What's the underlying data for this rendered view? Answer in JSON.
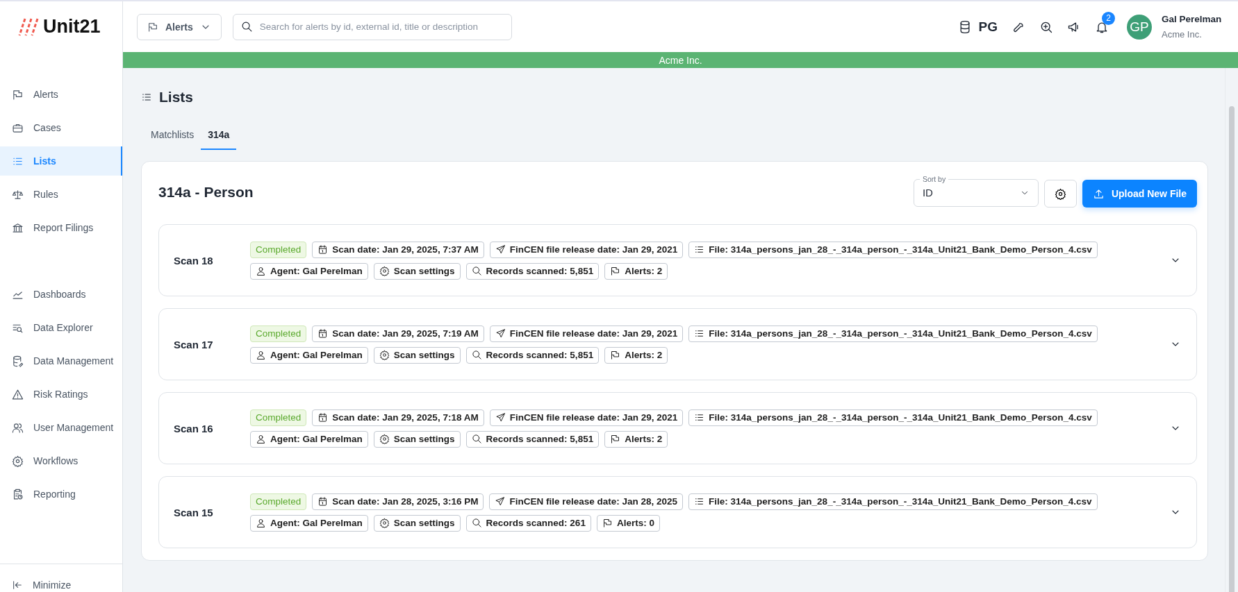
{
  "logo": {
    "text": "Unit21"
  },
  "header": {
    "module_selector": "Alerts",
    "search": {
      "placeholder": "Search for alerts by id, external id, title or description"
    },
    "tenant_code": "PG",
    "notification_count": "2",
    "user": {
      "initials": "GP",
      "name": "Gal Perelman",
      "org": "Acme Inc."
    }
  },
  "banner": "Acme Inc.",
  "sidebar": {
    "sections": [
      {
        "items": [
          {
            "label": "Alerts",
            "selected": false
          },
          {
            "label": "Cases",
            "selected": false
          },
          {
            "label": "Lists",
            "selected": true
          },
          {
            "label": "Rules",
            "selected": false
          },
          {
            "label": "Report Filings",
            "selected": false
          }
        ]
      },
      {
        "items": [
          {
            "label": "Dashboards",
            "selected": false
          },
          {
            "label": "Data Explorer",
            "selected": false
          },
          {
            "label": "Data Management",
            "selected": false
          },
          {
            "label": "Risk Ratings",
            "selected": false
          },
          {
            "label": "User Management",
            "selected": false
          },
          {
            "label": "Workflows",
            "selected": false
          },
          {
            "label": "Reporting",
            "selected": false
          }
        ]
      }
    ],
    "minimize": "Minimize"
  },
  "page": {
    "title": "Lists",
    "tabs": [
      {
        "label": "Matchlists",
        "selected": false
      },
      {
        "label": "314a",
        "selected": true
      }
    ],
    "card": {
      "title": "314a - Person",
      "sort": {
        "label": "Sort by",
        "value": "ID"
      },
      "upload_button": "Upload New File",
      "scans": [
        {
          "name": "Scan 18",
          "chip_rows": [
            {
              "chips": [
                {
                  "kind": "status",
                  "text": "Completed"
                },
                {
                  "kind": "scan_date",
                  "text": "Scan date: Jan 29, 2025, 7:37 AM"
                },
                {
                  "kind": "release",
                  "text": "FinCEN file release date: Jan 29, 2021"
                },
                {
                  "kind": "file",
                  "text": "File: 314a_persons_jan_28_-_314a_person_-_314a_Unit21_Bank_Demo_Person_4.csv"
                }
              ]
            },
            {
              "chips": [
                {
                  "kind": "agent",
                  "text": "Agent: Gal Perelman"
                },
                {
                  "kind": "settings",
                  "text": "Scan settings"
                },
                {
                  "kind": "records",
                  "text": "Records scanned: 5,851"
                },
                {
                  "kind": "alerts",
                  "text": "Alerts: 2"
                }
              ]
            }
          ]
        },
        {
          "name": "Scan 17",
          "chip_rows": [
            {
              "chips": [
                {
                  "kind": "status",
                  "text": "Completed"
                },
                {
                  "kind": "scan_date",
                  "text": "Scan date: Jan 29, 2025, 7:19 AM"
                },
                {
                  "kind": "release",
                  "text": "FinCEN file release date: Jan 29, 2021"
                },
                {
                  "kind": "file",
                  "text": "File: 314a_persons_jan_28_-_314a_person_-_314a_Unit21_Bank_Demo_Person_4.csv"
                }
              ]
            },
            {
              "chips": [
                {
                  "kind": "agent",
                  "text": "Agent: Gal Perelman"
                },
                {
                  "kind": "settings",
                  "text": "Scan settings"
                },
                {
                  "kind": "records",
                  "text": "Records scanned: 5,851"
                },
                {
                  "kind": "alerts",
                  "text": "Alerts: 2"
                }
              ]
            }
          ]
        },
        {
          "name": "Scan 16",
          "chip_rows": [
            {
              "chips": [
                {
                  "kind": "status",
                  "text": "Completed"
                },
                {
                  "kind": "scan_date",
                  "text": "Scan date: Jan 29, 2025, 7:18 AM"
                },
                {
                  "kind": "release",
                  "text": "FinCEN file release date: Jan 29, 2021"
                },
                {
                  "kind": "file",
                  "text": "File: 314a_persons_jan_28_-_314a_person_-_314a_Unit21_Bank_Demo_Person_4.csv"
                }
              ]
            },
            {
              "chips": [
                {
                  "kind": "agent",
                  "text": "Agent: Gal Perelman"
                },
                {
                  "kind": "settings",
                  "text": "Scan settings"
                },
                {
                  "kind": "records",
                  "text": "Records scanned: 5,851"
                },
                {
                  "kind": "alerts",
                  "text": "Alerts: 2"
                }
              ]
            }
          ]
        },
        {
          "name": "Scan 15",
          "chip_rows": [
            {
              "chips": [
                {
                  "kind": "status",
                  "text": "Completed"
                },
                {
                  "kind": "scan_date",
                  "text": "Scan date: Jan 28, 2025, 3:16 PM"
                },
                {
                  "kind": "release",
                  "text": "FinCEN file release date: Jan 28, 2025"
                },
                {
                  "kind": "file",
                  "text": "File: 314a_persons_jan_28_-_314a_person_-_314a_Unit21_Bank_Demo_Person_4.csv"
                }
              ]
            },
            {
              "chips": [
                {
                  "kind": "agent",
                  "text": "Agent: Gal Perelman"
                },
                {
                  "kind": "settings",
                  "text": "Scan settings"
                },
                {
                  "kind": "records",
                  "text": "Records scanned: 261"
                },
                {
                  "kind": "alerts",
                  "text": "Alerts: 0"
                }
              ]
            }
          ]
        }
      ]
    }
  }
}
